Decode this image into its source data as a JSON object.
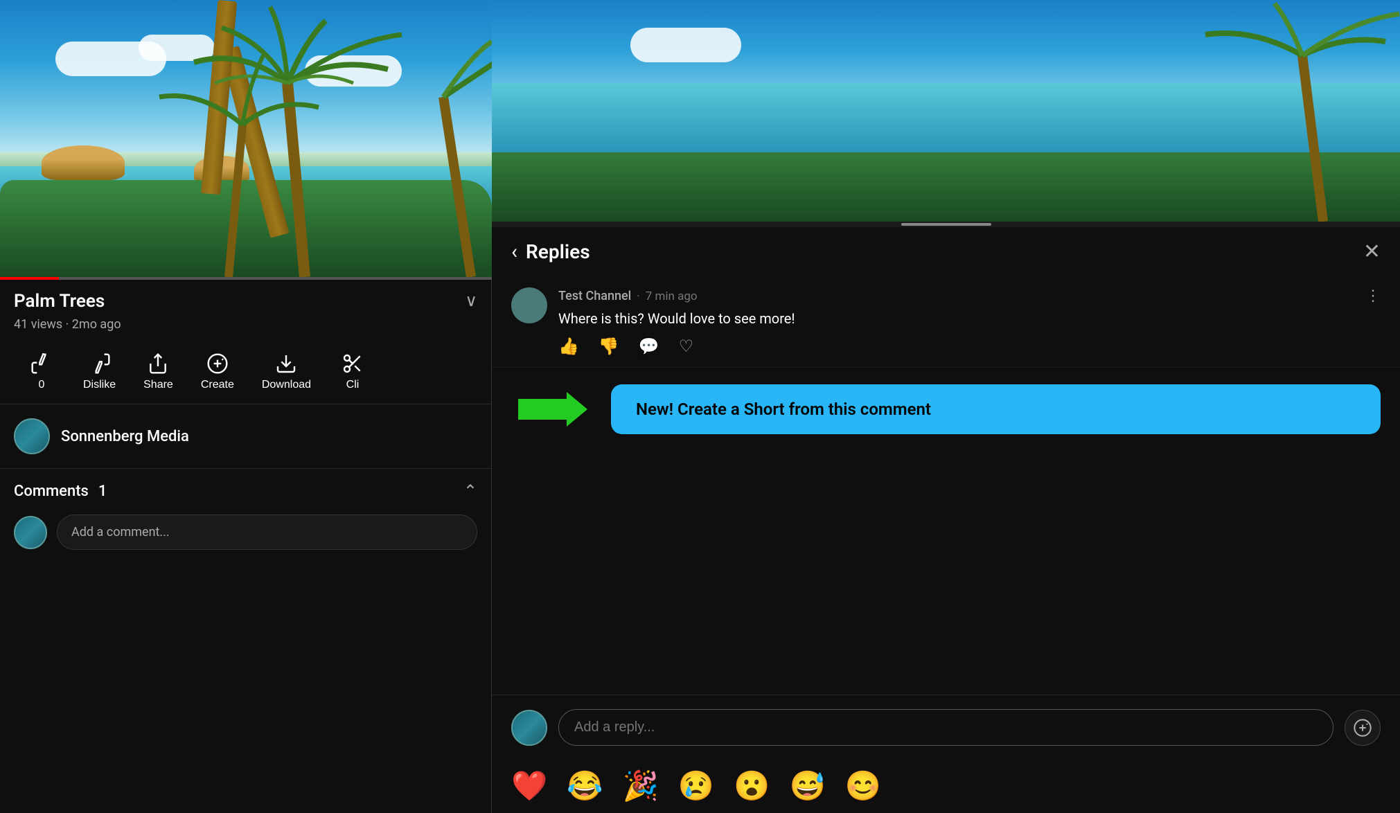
{
  "left": {
    "video": {
      "title": "Palm Trees",
      "views": "41 views",
      "age": "2mo ago",
      "views_age": "41 views · 2mo ago"
    },
    "actions": [
      {
        "id": "like",
        "icon": "👍",
        "label": "0",
        "svg": true
      },
      {
        "id": "dislike",
        "icon": "👎",
        "label": "Dislike",
        "svg": true
      },
      {
        "id": "share",
        "icon": "↗",
        "label": "Share",
        "svg": true
      },
      {
        "id": "create",
        "icon": "✂️",
        "label": "Create",
        "svg": true
      },
      {
        "id": "download",
        "icon": "⬇",
        "label": "Download",
        "svg": true
      },
      {
        "id": "clip",
        "icon": "✂",
        "label": "Cli...",
        "svg": true
      }
    ],
    "channel": {
      "name": "Sonnenberg Media"
    },
    "comments": {
      "label": "Comments",
      "count": "1",
      "placeholder": "Add a comment..."
    }
  },
  "right": {
    "replies_panel": {
      "title": "Replies",
      "back_label": "‹",
      "close_label": "✕",
      "comment": {
        "author": "Test Channel",
        "time": "7 min ago",
        "text": "Where is this? Would love to see more!"
      },
      "create_short_label": "New! Create a Short from this comment",
      "reply_placeholder": "Add a reply..."
    },
    "emojis": [
      "❤️",
      "😂",
      "🎉",
      "😢",
      "😮",
      "😅",
      "😊"
    ]
  }
}
